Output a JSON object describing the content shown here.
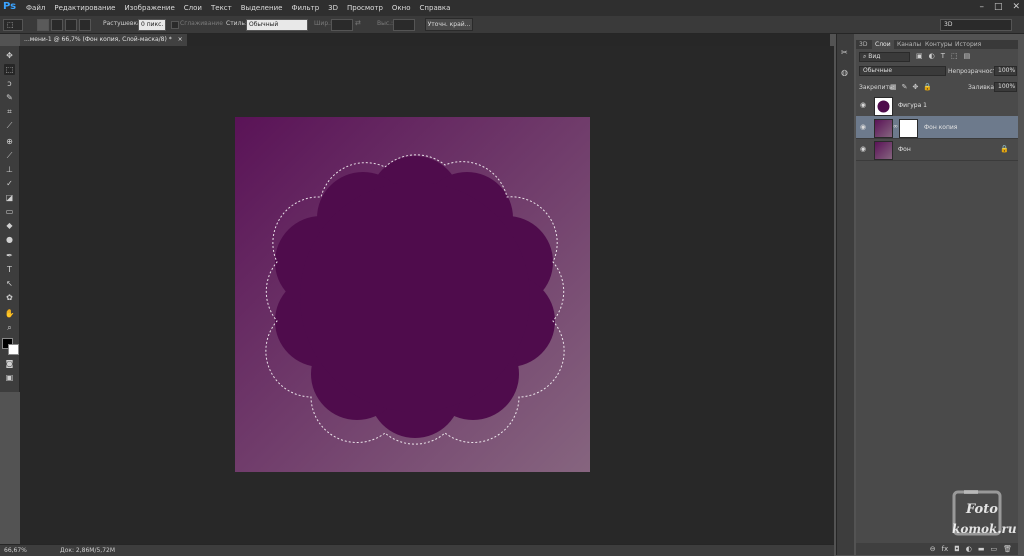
{
  "app": {
    "logo": "Ps"
  },
  "menu": [
    "Файл",
    "Редактирование",
    "Изображение",
    "Слои",
    "Текст",
    "Выделение",
    "Фильтр",
    "3D",
    "Просмотр",
    "Окно",
    "Справка"
  ],
  "window_controls": [
    "–",
    "□",
    "✕"
  ],
  "options": {
    "feather_label": "Растушевка:",
    "feather_value": "0 пикс.",
    "antialias_label": "Сглаживание",
    "style_label": "Стиль:",
    "style_value": "Обычный",
    "width_label": "Шир.:",
    "height_label": "Выс.:",
    "refine_button": "Уточн. край...",
    "workspace": "3D"
  },
  "document": {
    "tab_title": "...мени-1 @ 66,7% (Фон копия, Слой-маска/8) *"
  },
  "colors": {
    "accent": "#3aa3ff",
    "shape_fill": "#4f0c4c",
    "gradient_dark": "#5a1357",
    "gradient_light": "#86657f",
    "selected_row": "#6d7a8c"
  },
  "toolbar": {
    "tools": [
      "move-icon",
      "marquee-icon",
      "lasso-icon",
      "quick-select-icon",
      "crop-icon",
      "eyedropper-icon",
      "healing-icon",
      "brush-icon",
      "stamp-icon",
      "history-brush-icon",
      "eraser-icon",
      "gradient-icon",
      "blur-icon",
      "dodge-icon",
      "pen-icon",
      "type-icon",
      "path-select-icon",
      "shape-icon",
      "hand-icon",
      "zoom-icon"
    ]
  },
  "status": {
    "zoom": "66,67%",
    "doc_info": "Док: 2,86M/5,72M"
  },
  "layers_panel": {
    "tabs": [
      "3D",
      "Слои",
      "Каналы",
      "Контуры",
      "История"
    ],
    "filter_label": "Вид",
    "blend_mode": "Обычные",
    "opacity_label": "Непрозрачность:",
    "opacity_value": "100%",
    "lock_label": "Закрепить:",
    "fill_label": "Заливка:",
    "fill_value": "100%",
    "layers": [
      {
        "name": "Фигура 1",
        "selected": false
      },
      {
        "name": "Фон копия",
        "selected": true
      },
      {
        "name": "Фон",
        "selected": false
      }
    ],
    "footer_icons": [
      "link-icon",
      "fx-icon",
      "mask-icon",
      "adjustment-icon",
      "folder-icon",
      "new-layer-icon",
      "trash-icon"
    ]
  },
  "watermark": {
    "line1": "Foto",
    "line2": "komok.ru"
  }
}
